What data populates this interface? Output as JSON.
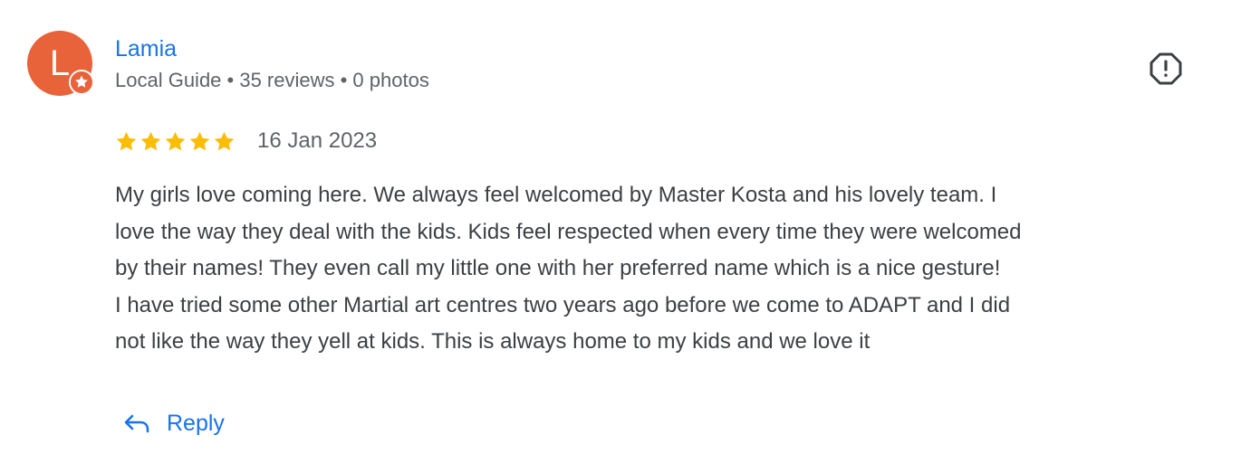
{
  "reviewer": {
    "initial": "L",
    "name": "Lamia",
    "meta": "Local Guide • 35 reviews • 0 photos",
    "avatar_color": "#e8623a"
  },
  "review": {
    "rating": 5,
    "max_rating": 5,
    "date": "16 Jan 2023",
    "text_lines": [
      "My girls love coming here. We always feel welcomed by Master Kosta and his lovely team. I",
      "love the way they deal with the kids. Kids feel respected when every time they were welcomed",
      "by their names! They even call my little one with her preferred name which is a nice gesture!",
      "I have tried some other Martial art centres two years ago before we come to ADAPT and I did",
      "not like the way they yell at kids. This is always home to my kids and we love it"
    ]
  },
  "actions": {
    "reply_label": "Reply",
    "report_icon": "report-flag-icon"
  },
  "icons": {
    "local_guide_badge": "star-badge-icon",
    "star": "star-icon",
    "reply": "reply-arrow-icon"
  },
  "colors": {
    "link_blue": "#1a73e8",
    "star_gold": "#fbbc04",
    "badge_orange": "#e8623a",
    "text_gray": "#5f6368",
    "body_text": "#3c4043",
    "icon_dark": "#3c4043"
  }
}
